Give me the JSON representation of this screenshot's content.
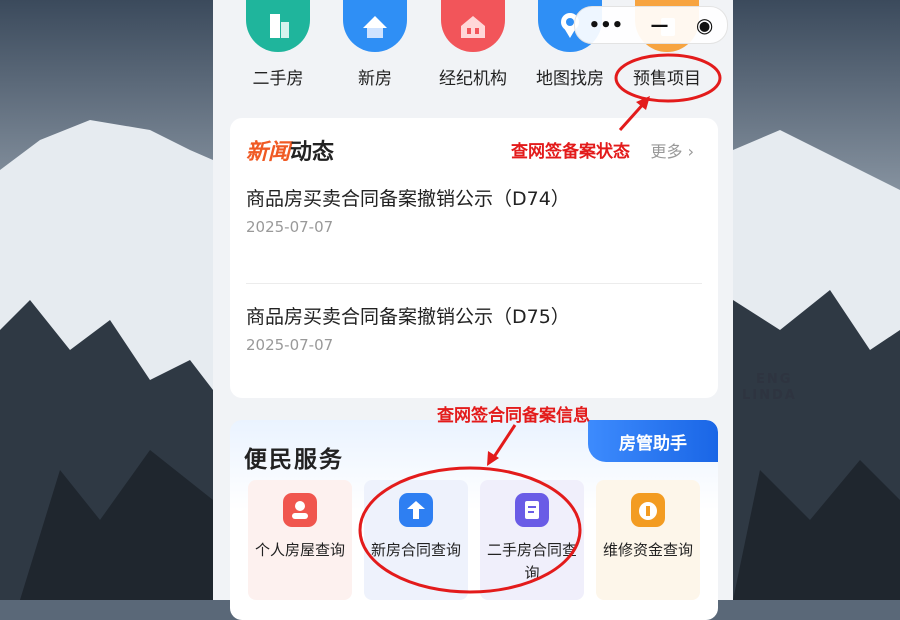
{
  "categories": [
    {
      "label": "二手房",
      "icon": "building-icon",
      "color": "#1fb59c"
    },
    {
      "label": "新房",
      "icon": "house-icon",
      "color": "#2f8ff5"
    },
    {
      "label": "经纪机构",
      "icon": "agency-icon",
      "color": "#f2555a"
    },
    {
      "label": "地图找房",
      "icon": "map-pin-icon",
      "color": "#2f8ff5"
    },
    {
      "label": "预售项目",
      "icon": "presale-icon",
      "color": "#f7a440"
    }
  ],
  "capsule": {
    "more": "•••",
    "minimize": "—",
    "close": "◉"
  },
  "news": {
    "title_highlight": "新闻",
    "title_rest": "动态",
    "more": "更多",
    "items": [
      {
        "title": "商品房买卖合同备案撤销公示（D74）",
        "date": "2025-07-07"
      },
      {
        "title": "商品房买卖合同备案撤销公示（D75）",
        "date": "2025-07-07"
      }
    ]
  },
  "service": {
    "title": "便民服务",
    "tag": "房管助手",
    "items": [
      {
        "label": "个人房屋查询",
        "icon": "person-house-icon",
        "bg": "#fdf1ef",
        "color": "#f0564e"
      },
      {
        "label": "新房合同查询",
        "icon": "new-house-contract-icon",
        "bg": "#eef2fc",
        "color": "#2e7ff2"
      },
      {
        "label": "二手房合同查询",
        "icon": "resale-contract-icon",
        "bg": "#f0effb",
        "color": "#6a5ce6"
      },
      {
        "label": "维修资金查询",
        "icon": "repair-fund-icon",
        "bg": "#fdf6ea",
        "color": "#f39c22"
      }
    ]
  },
  "annotations": {
    "presale_status": "查网签备案状态",
    "contract_info": "查网签合同备案信息"
  },
  "watermark": {
    "line1": "ENG",
    "line2": "LINDA"
  }
}
